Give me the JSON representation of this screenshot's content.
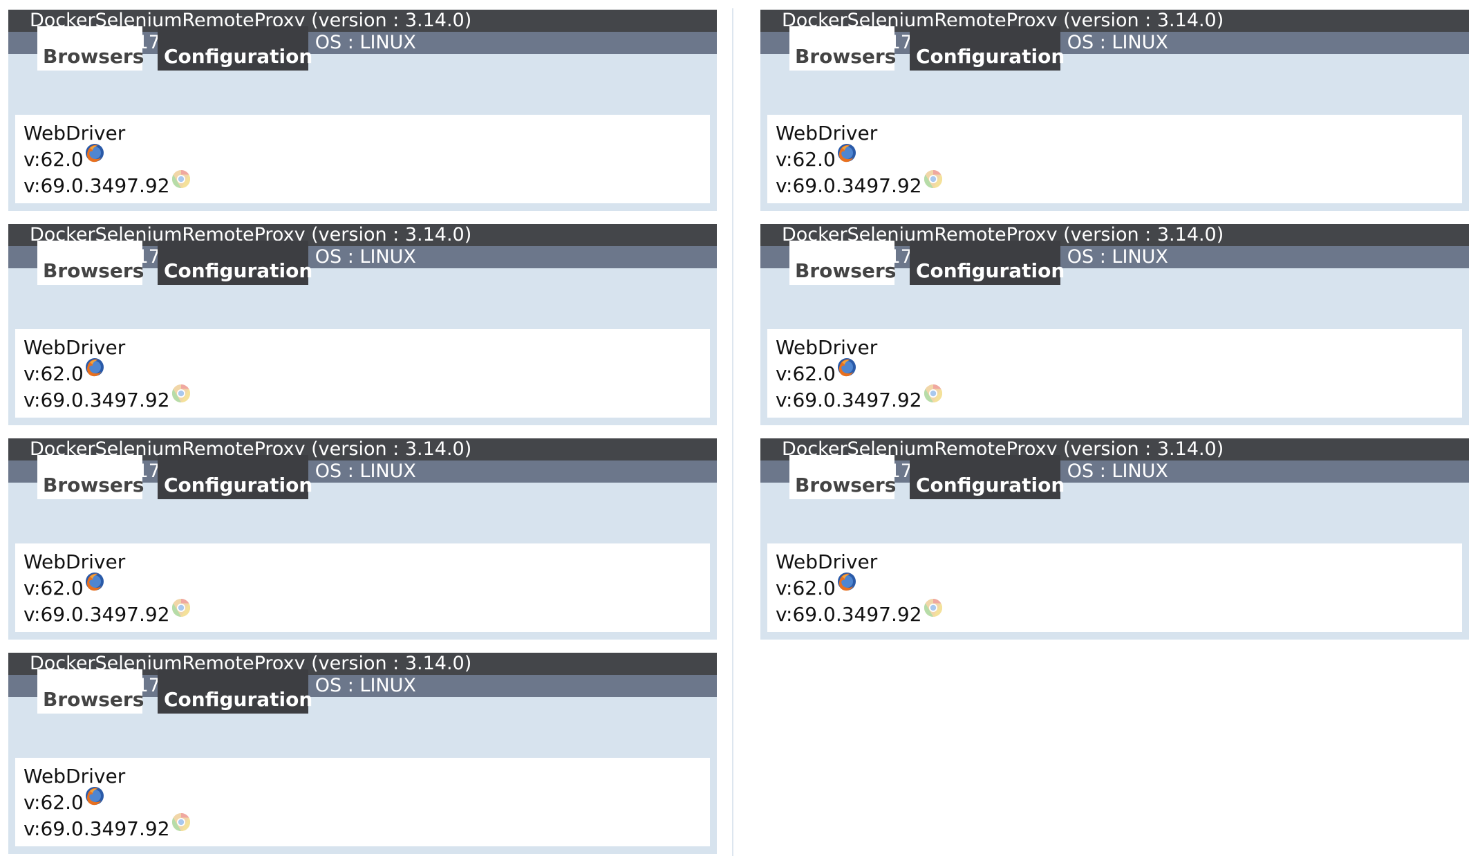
{
  "tabs": {
    "browsers_label": "Browsers",
    "configuration_label": "Configuration"
  },
  "proxies": [
    {
      "title": "DockerSeleniumRemoteProxy (version : 3.14.0)",
      "id_line": "id : http://172.17.0.4:40016, OS : LINUX",
      "protocol": "WebDriver",
      "browsers": [
        {
          "version": "v:62.0",
          "icon": "firefox-icon"
        },
        {
          "version": "v:69.0.3497.92",
          "icon": "chrome-icon"
        }
      ]
    },
    {
      "title": "DockerSeleniumRemoteProxy (version : 3.14.0)",
      "id_line": "id : http://172.17.0.3:40017, OS : LINUX",
      "protocol": "WebDriver",
      "browsers": [
        {
          "version": "v:62.0",
          "icon": "firefox-icon"
        },
        {
          "version": "v:69.0.3497.92",
          "icon": "chrome-icon"
        }
      ]
    },
    {
      "title": "DockerSeleniumRemoteProxy (version : 3.14.0)",
      "id_line": "id : http://172.17.0.8:40021, OS : LINUX",
      "protocol": "WebDriver",
      "browsers": [
        {
          "version": "v:62.0",
          "icon": "firefox-icon"
        },
        {
          "version": "v:69.0.3497.92",
          "icon": "chrome-icon"
        }
      ]
    },
    {
      "title": "DockerSeleniumRemoteProxy (version : 3.14.0)",
      "id_line": "id : http://172.17.0.6:40019, OS : LINUX",
      "protocol": "WebDriver",
      "browsers": [
        {
          "version": "v:62.0",
          "icon": "firefox-icon"
        },
        {
          "version": "v:69.0.3497.92",
          "icon": "chrome-icon"
        }
      ]
    },
    {
      "title": "DockerSeleniumRemoteProxy (version : 3.14.0)",
      "id_line": "id : http://172.17.0.5:40018, OS : LINUX",
      "protocol": "WebDriver",
      "browsers": [
        {
          "version": "v:62.0",
          "icon": "firefox-icon"
        },
        {
          "version": "v:69.0.3497.92",
          "icon": "chrome-icon"
        }
      ]
    },
    {
      "title": "DockerSeleniumRemoteProxy (version : 3.14.0)",
      "id_line": "id : http://172.17.0.7:40020, OS : LINUX",
      "protocol": "WebDriver",
      "browsers": [
        {
          "version": "v:62.0",
          "icon": "firefox-icon"
        },
        {
          "version": "v:69.0.3497.92",
          "icon": "chrome-icon"
        }
      ]
    },
    {
      "title": "DockerSeleniumRemoteProxy (version : 3.14.0)",
      "id_line": "id : http://172.17.0.9:40022, OS : LINUX",
      "protocol": "WebDriver",
      "browsers": [
        {
          "version": "v:62.0",
          "icon": "firefox-icon"
        },
        {
          "version": "v:69.0.3497.92",
          "icon": "chrome-icon"
        }
      ]
    }
  ],
  "colors": {
    "title_bar": "#44464a",
    "id_bar": "#6c778b",
    "panel_bg": "#d7e3ee",
    "config_tab": "#3d3e42"
  }
}
